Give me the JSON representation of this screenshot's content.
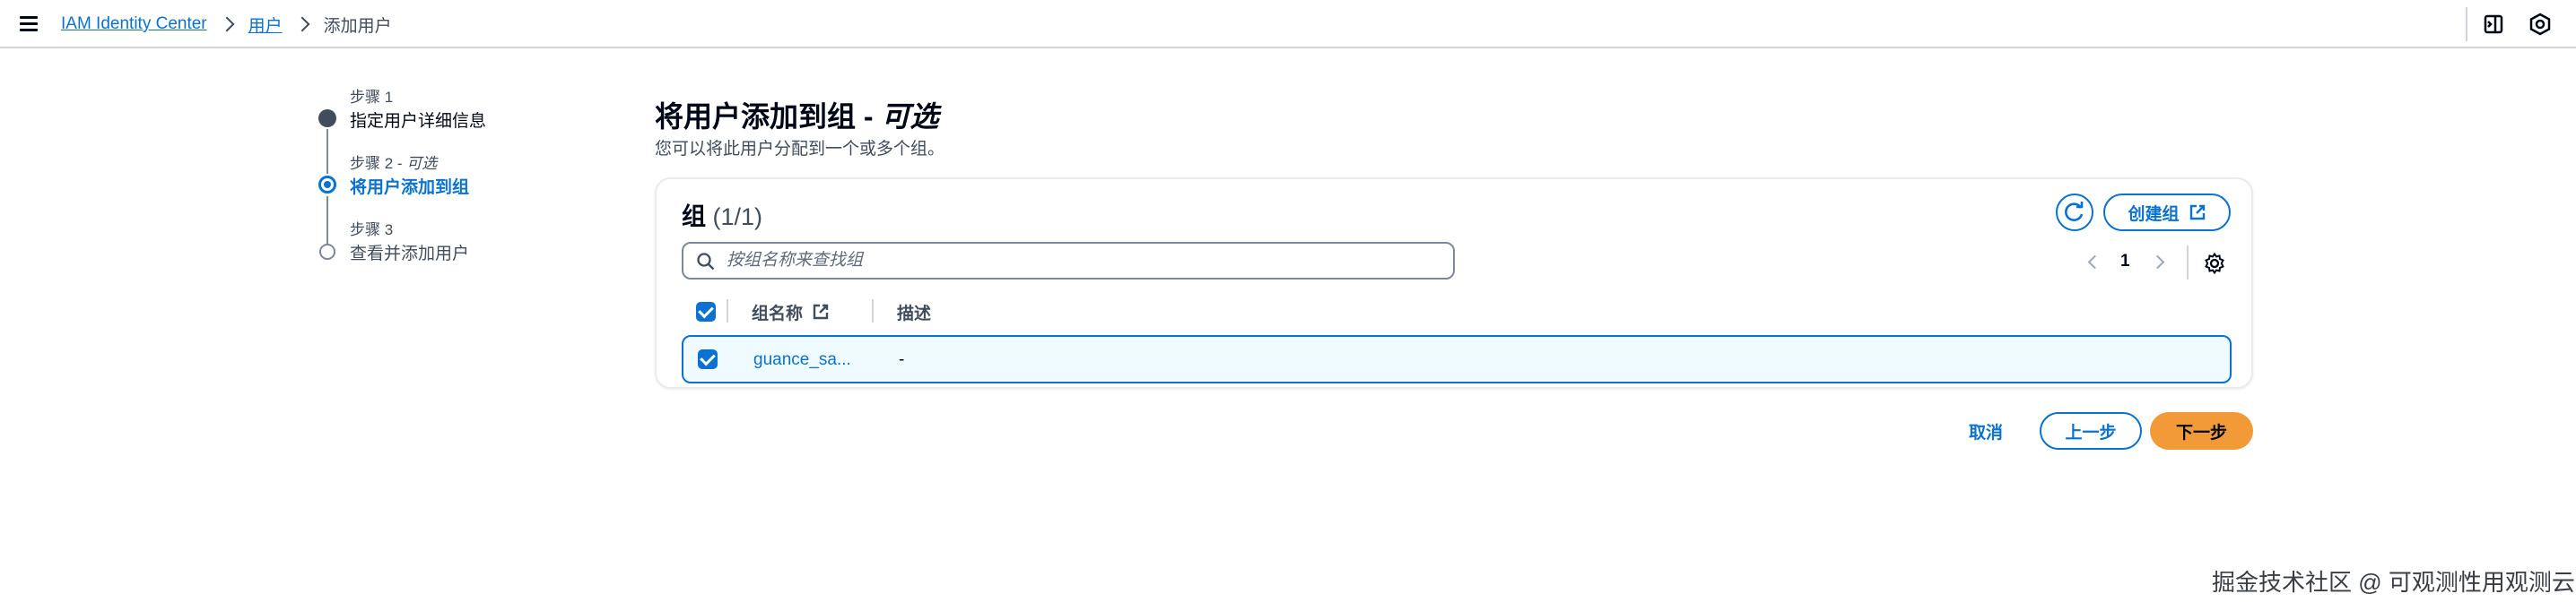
{
  "breadcrumb": {
    "items": [
      "IAM Identity Center",
      "用户"
    ],
    "current": "添加用户"
  },
  "top_icons": [
    "panel-icon",
    "notifications-icon"
  ],
  "steps": [
    {
      "number": "步骤 1",
      "label": "指定用户详细信息",
      "state": "completed"
    },
    {
      "number": "步骤 2",
      "optional": "可选",
      "label": "将用户添加到组",
      "state": "active"
    },
    {
      "number": "步骤 3",
      "label": "查看并添加用户",
      "state": "pending"
    }
  ],
  "page": {
    "title": "将用户添加到组",
    "title_optional": "可选",
    "subtitle": "您可以将此用户分配到一个或多个组。"
  },
  "groups": {
    "title": "组",
    "count": "(1/1)",
    "create_label": "创建组",
    "search_placeholder": "按组名称来查找组",
    "page_number": "1",
    "columns": [
      "组名称",
      "描述"
    ],
    "rows": [
      {
        "name": "guance_sa...",
        "description": "-",
        "selected": true
      }
    ]
  },
  "actions": {
    "cancel": "取消",
    "previous": "上一步",
    "next": "下一步"
  },
  "colors": {
    "accent": "#0972d3",
    "primary_button": "#f29a38",
    "text": "#000716",
    "secondary_text": "#414d5c"
  },
  "watermark": "掘金技术社区 @ 可观测性用观测云"
}
